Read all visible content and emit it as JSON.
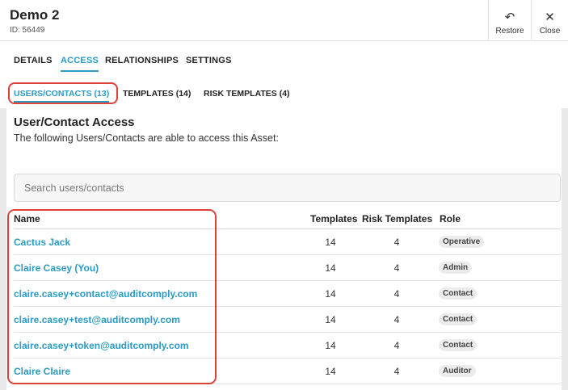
{
  "header": {
    "title": "Demo 2",
    "id_text": "ID: 56449",
    "restore_label": "Restore",
    "close_label": "Close",
    "restore_icon": "↶",
    "close_icon": "✕"
  },
  "tabs": [
    {
      "label": "DETAILS",
      "active": false
    },
    {
      "label": "ACCESS",
      "active": true
    },
    {
      "label": "RELATIONSHIPS",
      "active": false
    },
    {
      "label": "SETTINGS",
      "active": false
    }
  ],
  "subtabs": [
    {
      "label": "USERS/CONTACTS (13)",
      "active": true
    },
    {
      "label": "TEMPLATES (14)",
      "active": false
    },
    {
      "label": "RISK TEMPLATES (4)",
      "active": false
    }
  ],
  "section": {
    "title": "User/Contact Access",
    "description": "The following Users/Contacts are able to access this Asset:"
  },
  "search": {
    "placeholder": "Search users/contacts",
    "value": ""
  },
  "table": {
    "headers": {
      "name": "Name",
      "templates": "Templates",
      "risk_templates": "Risk Templates",
      "role": "Role"
    },
    "rows": [
      {
        "name": "Cactus Jack",
        "templates": "14",
        "risk_templates": "4",
        "role": "Operative"
      },
      {
        "name": "Claire Casey (You)",
        "templates": "14",
        "risk_templates": "4",
        "role": "Admin"
      },
      {
        "name": "claire.casey+contact@auditcomply.com",
        "templates": "14",
        "risk_templates": "4",
        "role": "Contact"
      },
      {
        "name": "claire.casey+test@auditcomply.com",
        "templates": "14",
        "risk_templates": "4",
        "role": "Contact"
      },
      {
        "name": "claire.casey+token@auditcomply.com",
        "templates": "14",
        "risk_templates": "4",
        "role": "Contact"
      },
      {
        "name": "Claire Claire",
        "templates": "14",
        "risk_templates": "4",
        "role": "Auditor"
      }
    ]
  },
  "colors": {
    "accent": "#2a9bc4",
    "highlight": "#e0403a"
  }
}
